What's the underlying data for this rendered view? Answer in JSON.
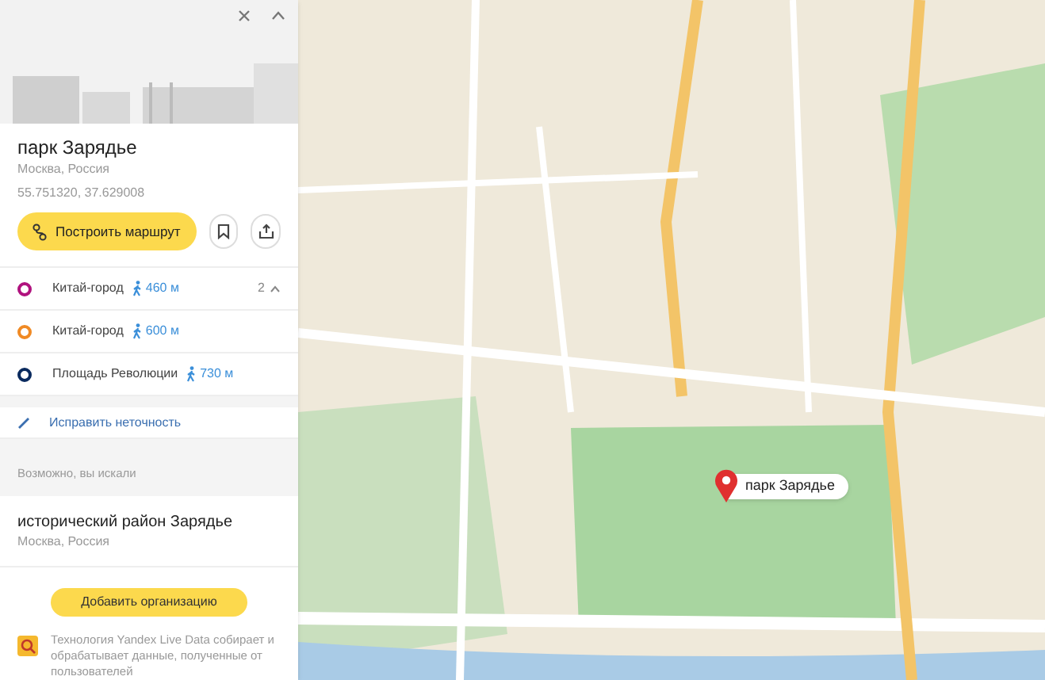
{
  "place": {
    "title": "парк Зарядье",
    "subtitle": "Москва, Россия",
    "coordinates": "55.751320, 37.629008",
    "route_button": "Построить маршрут"
  },
  "metro": [
    {
      "name": "Китай-город",
      "distance": "460 м",
      "color": "#b0127e",
      "more": {
        "count": "2",
        "expanded": true
      }
    },
    {
      "name": "Китай-город",
      "distance": "600 м",
      "color": "#f08a24"
    },
    {
      "name": "Площадь Революции",
      "distance": "730 м",
      "color": "#0a2a5e"
    }
  ],
  "fix_link": "Исправить неточность",
  "suggestions": {
    "heading": "Возможно, вы искали",
    "items": [
      {
        "title": "исторический район Зарядье",
        "subtitle": "Москва, Россия"
      }
    ]
  },
  "add_button": "Добавить организацию",
  "notice": "Технология Yandex Live Data собирает и обрабатывает данные, полученные от пользователей",
  "map": {
    "pin_label": "парк Зарядье"
  }
}
